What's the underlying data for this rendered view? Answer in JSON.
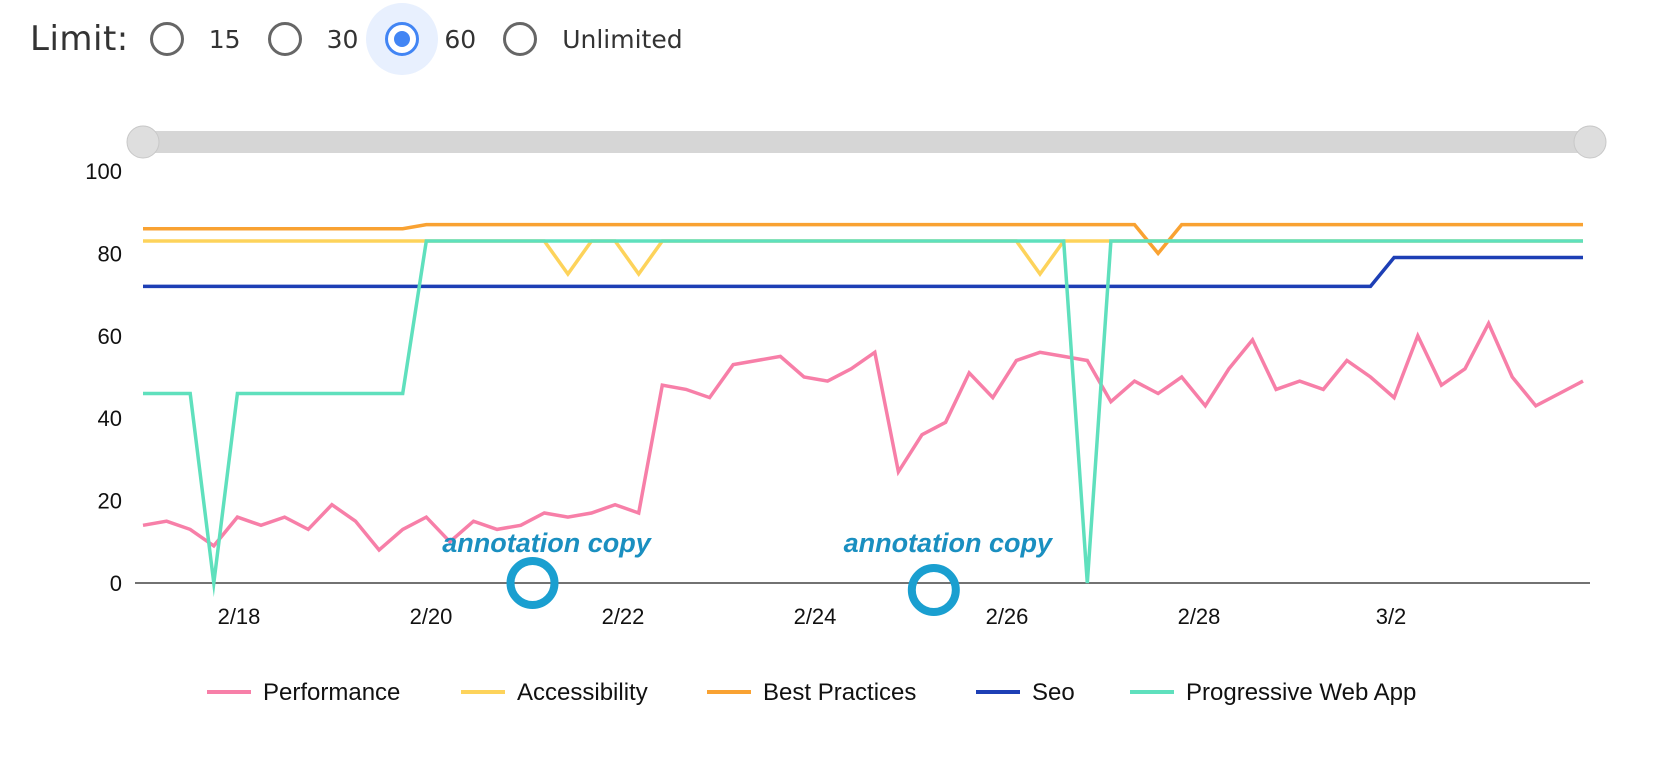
{
  "limit": {
    "label": "Limit:",
    "options": [
      {
        "label": "15",
        "selected": false
      },
      {
        "label": "30",
        "selected": false
      },
      {
        "label": "60",
        "selected": true
      },
      {
        "label": "Unlimited",
        "selected": false
      }
    ]
  },
  "chart_data": {
    "type": "line",
    "x_start": "2/17",
    "x_end": "3/3",
    "x_tick_labels": [
      "2/18",
      "2/20",
      "2/22",
      "2/24",
      "2/26",
      "2/28",
      "3/2"
    ],
    "ylim": [
      0,
      100
    ],
    "y_ticks": [
      0,
      20,
      40,
      60,
      80,
      100
    ],
    "grid": false,
    "legend_position": "bottom",
    "range_slider": true,
    "series": [
      {
        "name": "Performance",
        "color": "#f77fa8",
        "values": [
          14,
          15,
          13,
          9,
          16,
          14,
          16,
          13,
          19,
          15,
          8,
          13,
          16,
          10,
          15,
          13,
          14,
          17,
          16,
          17,
          19,
          17,
          48,
          47,
          45,
          53,
          54,
          55,
          50,
          49,
          52,
          56,
          27,
          36,
          39,
          51,
          45,
          54,
          56,
          55,
          54,
          44,
          49,
          46,
          50,
          43,
          52,
          59,
          47,
          49,
          47,
          54,
          50,
          45,
          60,
          48,
          52,
          63,
          50,
          43,
          46,
          49
        ]
      },
      {
        "name": "Accessibility",
        "color": "#fdd35b",
        "values": [
          83,
          83,
          83,
          83,
          83,
          83,
          83,
          83,
          83,
          83,
          83,
          83,
          83,
          83,
          83,
          83,
          83,
          83,
          75,
          83,
          83,
          75,
          83,
          83,
          83,
          83,
          83,
          83,
          83,
          83,
          83,
          83,
          83,
          83,
          83,
          83,
          83,
          83,
          75,
          83,
          83,
          83,
          83,
          83,
          83,
          83,
          83,
          83,
          83,
          83,
          83,
          83,
          83,
          83,
          83,
          83,
          83,
          83,
          83,
          83,
          83,
          83
        ]
      },
      {
        "name": "Best Practices",
        "color": "#f9a232",
        "values": [
          86,
          86,
          86,
          86,
          86,
          86,
          86,
          86,
          86,
          86,
          86,
          86,
          87,
          87,
          87,
          87,
          87,
          87,
          87,
          87,
          87,
          87,
          87,
          87,
          87,
          87,
          87,
          87,
          87,
          87,
          87,
          87,
          87,
          87,
          87,
          87,
          87,
          87,
          87,
          87,
          87,
          87,
          87,
          80,
          87,
          87,
          87,
          87,
          87,
          87,
          87,
          87,
          87,
          87,
          87,
          87,
          87,
          87,
          87,
          87,
          87,
          87
        ]
      },
      {
        "name": "Seo",
        "color": "#1d3fb5",
        "values": [
          72,
          72,
          72,
          72,
          72,
          72,
          72,
          72,
          72,
          72,
          72,
          72,
          72,
          72,
          72,
          72,
          72,
          72,
          72,
          72,
          72,
          72,
          72,
          72,
          72,
          72,
          72,
          72,
          72,
          72,
          72,
          72,
          72,
          72,
          72,
          72,
          72,
          72,
          72,
          72,
          72,
          72,
          72,
          72,
          72,
          72,
          72,
          72,
          72,
          72,
          72,
          72,
          72,
          79,
          79,
          79,
          79,
          79,
          79,
          79,
          79,
          79
        ]
      },
      {
        "name": "Progressive Web App",
        "color": "#5fe0bd",
        "values": [
          46,
          46,
          46,
          0,
          46,
          46,
          46,
          46,
          46,
          46,
          46,
          46,
          83,
          83,
          83,
          83,
          83,
          83,
          83,
          83,
          83,
          83,
          83,
          83,
          83,
          83,
          83,
          83,
          83,
          83,
          83,
          83,
          83,
          83,
          83,
          83,
          83,
          83,
          83,
          83,
          0,
          83,
          83,
          83,
          83,
          83,
          83,
          83,
          83,
          83,
          83,
          83,
          83,
          83,
          83,
          83,
          83,
          83,
          83,
          83,
          83,
          83
        ]
      }
    ],
    "annotations": [
      {
        "text": "annotation copy",
        "x_index": 16.5
      },
      {
        "text": "annotation copy",
        "x_index": 33.5
      }
    ],
    "annotation_color": "#1a9fd0"
  }
}
